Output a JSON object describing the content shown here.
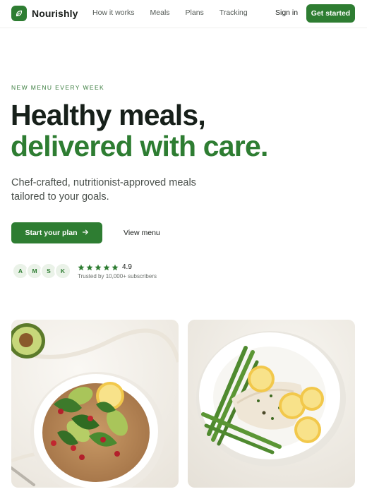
{
  "nav": {
    "brand": "Nourishly",
    "links": [
      "How it works",
      "Meals",
      "Plans",
      "Tracking"
    ],
    "signin": "Sign in",
    "cta": "Get started"
  },
  "hero": {
    "eyebrow": "NEW MENU EVERY WEEK",
    "headline_1": "Healthy meals,",
    "headline_2": "delivered with care.",
    "subtitle": "Chef-crafted, nutritionist-approved meals tailored to your goals.",
    "primary_cta": "Start your plan",
    "secondary_cta": "View menu",
    "avatars": [
      "A",
      "M",
      "S",
      "K"
    ],
    "rating": "4.9",
    "stars": 5,
    "trusted": "Trusted by 10,000+ subscribers"
  },
  "images": {
    "left": "salad-bowl-image",
    "right": "fish-asparagus-plate-image"
  },
  "colors": {
    "brand": "#2e7d32",
    "text": "#17201a",
    "muted": "#4a504c"
  }
}
